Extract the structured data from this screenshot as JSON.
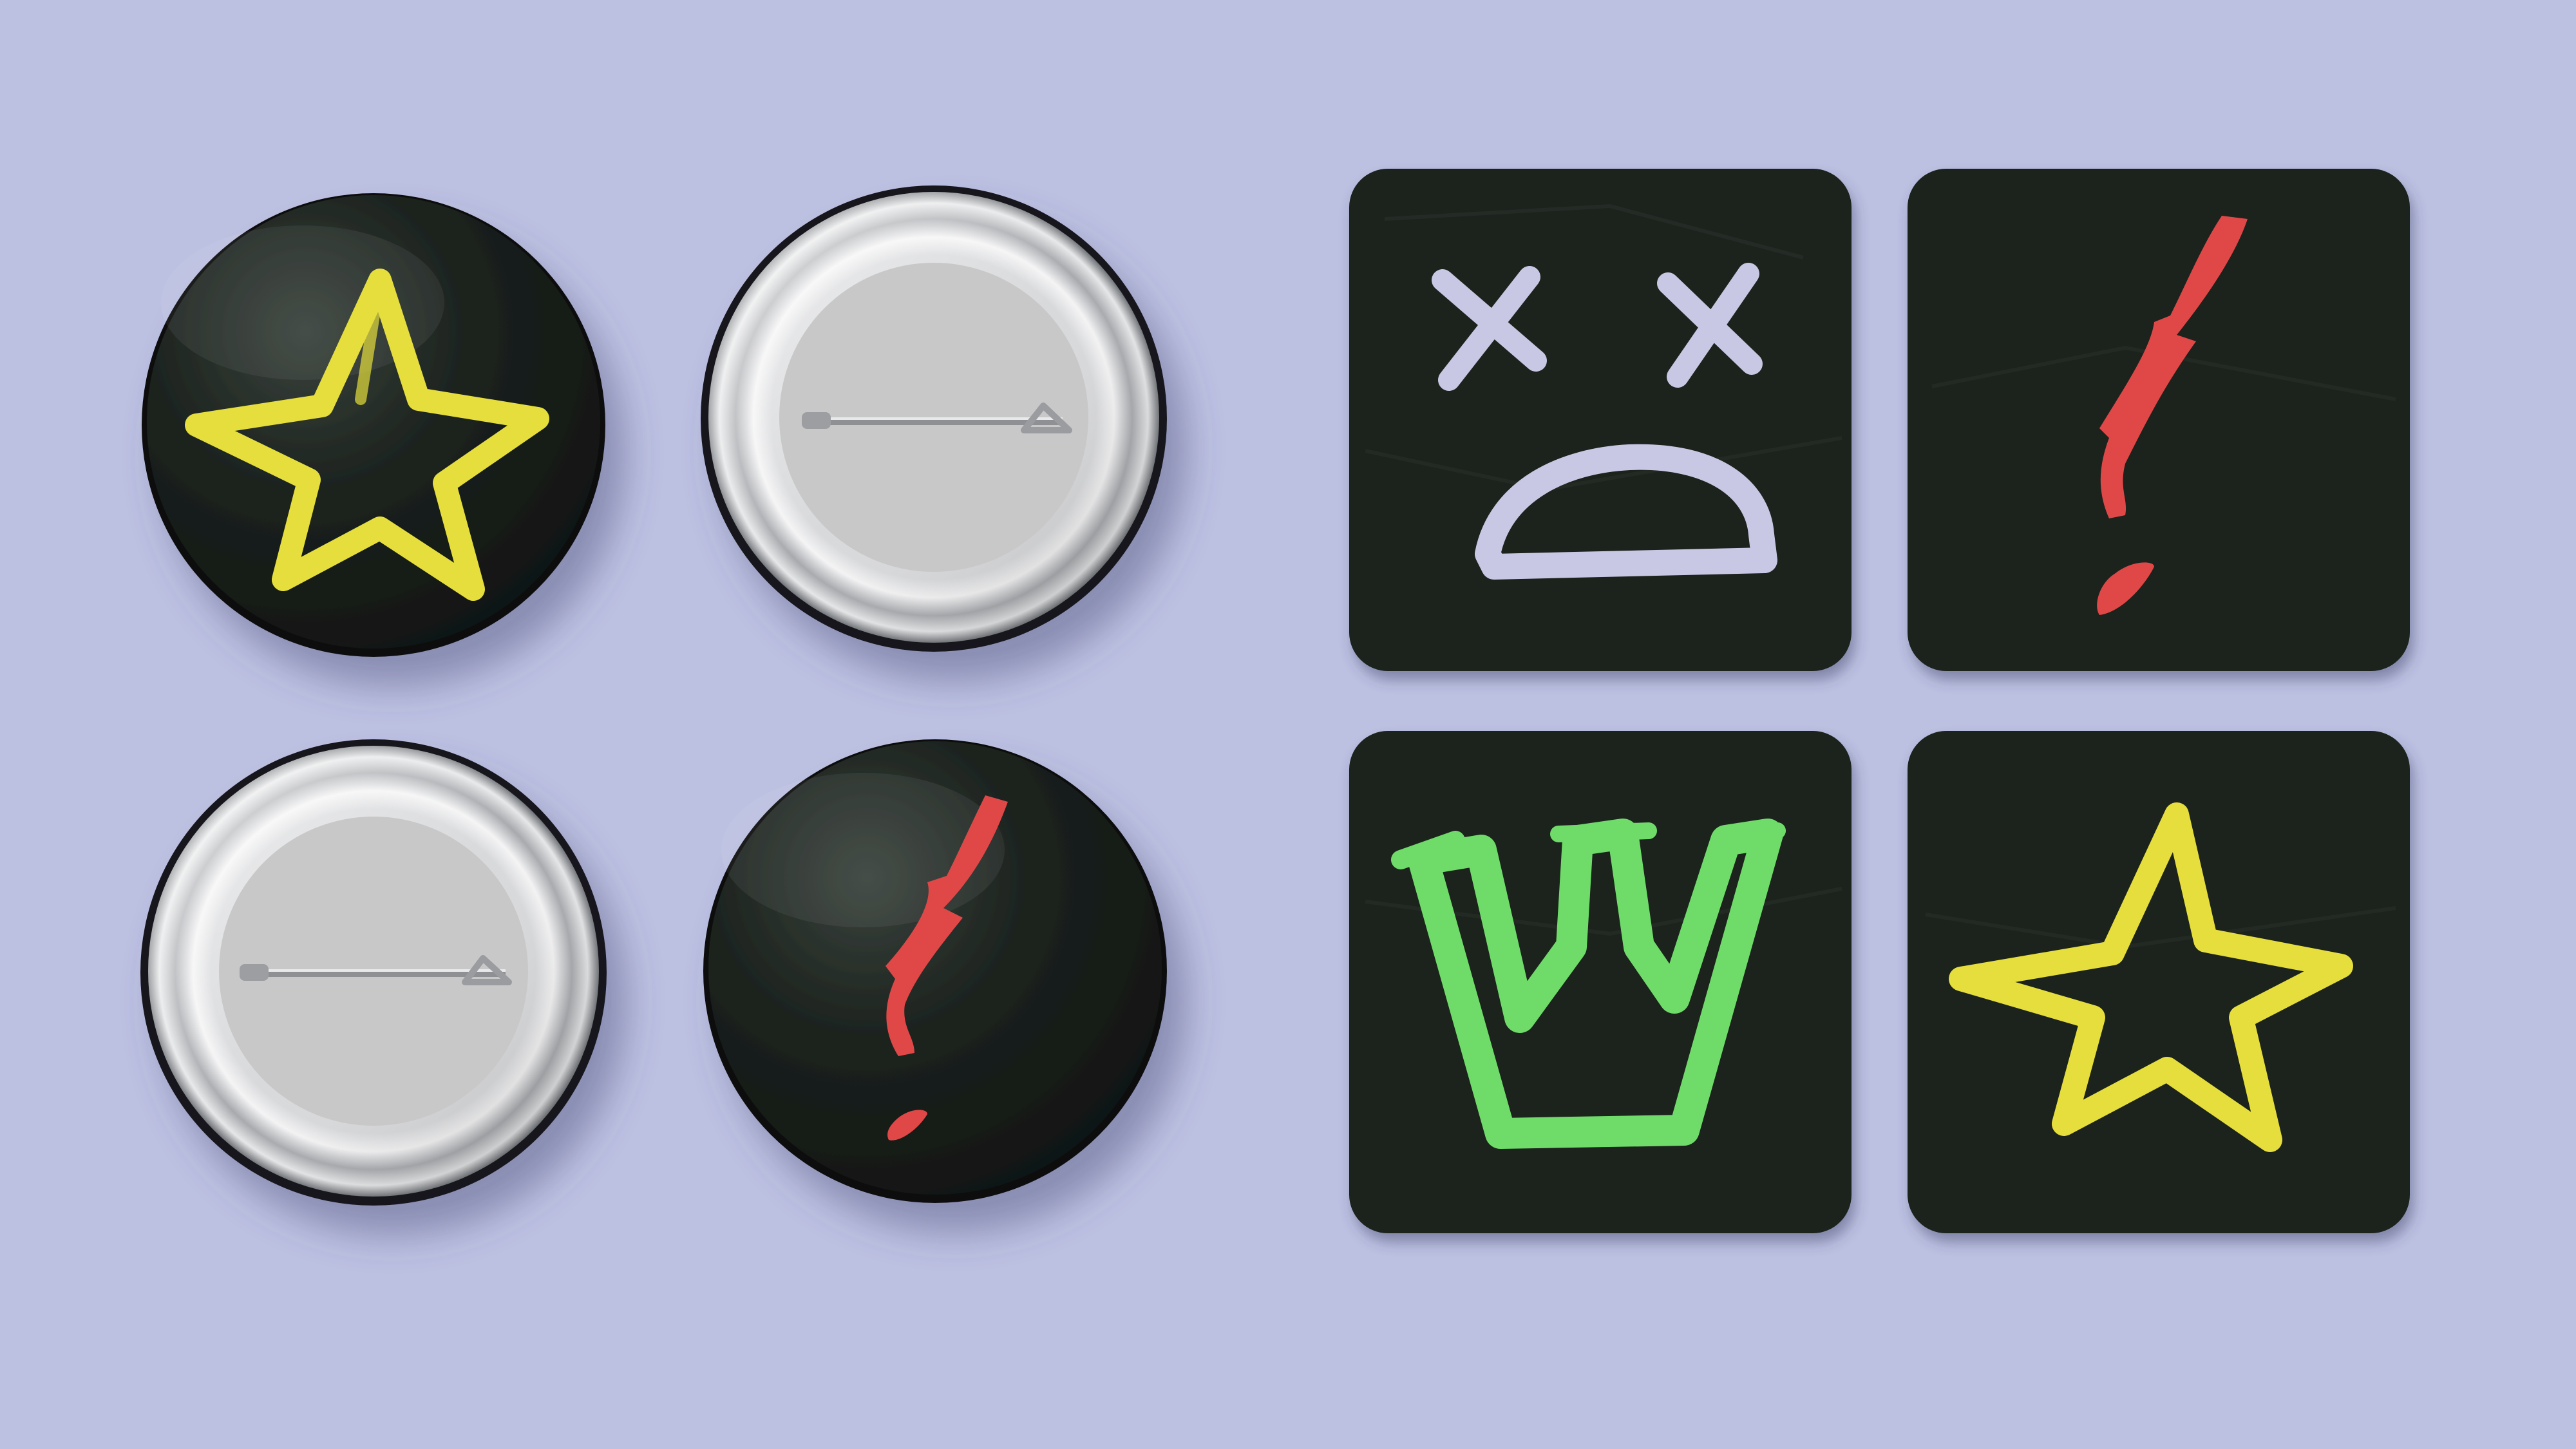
{
  "scene": {
    "background_color": "#bcc0e1",
    "badge_color": "#1a201c",
    "metal_color": "#c9cacc",
    "colors": {
      "yellow": "#e5de3c",
      "red": "#e04848",
      "lavender": "#c9c8e4",
      "green": "#6fdc6a"
    },
    "pins": [
      {
        "kind": "front",
        "icon": "star-icon"
      },
      {
        "kind": "back",
        "icon": "safety-pin-icon"
      },
      {
        "kind": "back",
        "icon": "safety-pin-icon"
      },
      {
        "kind": "front",
        "icon": "exclamation-icon"
      }
    ],
    "stickers": [
      {
        "icon": "dead-face-icon"
      },
      {
        "icon": "exclamation-icon"
      },
      {
        "icon": "crown-icon"
      },
      {
        "icon": "star-icon"
      }
    ]
  }
}
